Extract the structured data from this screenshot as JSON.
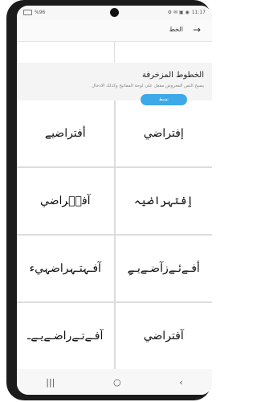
{
  "statusbar": {
    "left": "%96",
    "right_icons": "⚙ ✉ ▣ ◉",
    "time": "11:17"
  },
  "topbar": {
    "title": "الخط"
  },
  "section": {
    "title": "الخطوط المزخرفة",
    "description": "يصبح النص المعروض مفعل على لوحة المفاتيح وكذلك الادخال"
  },
  "badge": "نشيط",
  "fonts": [
    "إفتراضي",
    "أفتراضيے",
    "ٳفتہراضيہ",
    "آفتۘراضي",
    "أفـےئـےزآضـےيـےِ",
    "آفـہتـہراضہيء",
    "آفتراضي",
    "آفـےتـےراضـےيـےـ"
  ],
  "navbar": {
    "recent": "|||",
    "home": "○",
    "back": "‹"
  }
}
